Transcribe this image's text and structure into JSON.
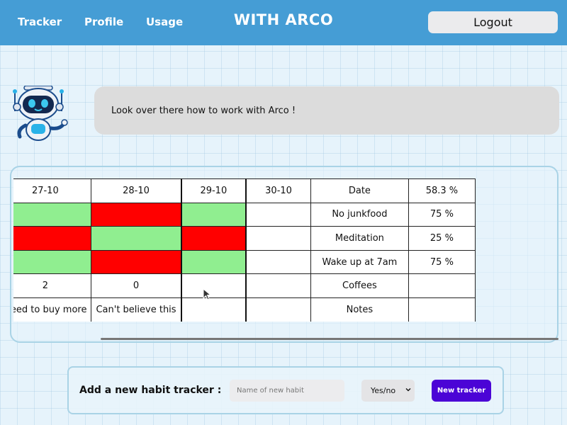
{
  "navbar": {
    "links": [
      "Tracker",
      "Profile",
      "Usage"
    ],
    "brand": "WITH ARCO",
    "logout_label": "Logout",
    "color": "#459dd5"
  },
  "assistant": {
    "message": "Look over there how to work with Arco !"
  },
  "tracker": {
    "first_col_partial": [
      "",
      "",
      "",
      "",
      "e"
    ],
    "dates": [
      "27-10",
      "28-10",
      "29-10",
      "30-10"
    ],
    "summary_header": {
      "label": "Date",
      "value": "58.3 %"
    },
    "rows": [
      {
        "label": "No junkfood",
        "value": "75 %",
        "cells": [
          "done",
          "done",
          "missed",
          "done",
          "empty"
        ]
      },
      {
        "label": "Meditation",
        "value": "25 %",
        "cells": [
          "missed",
          "missed",
          "done",
          "missed",
          "empty"
        ]
      },
      {
        "label": "Wake up at 7am",
        "value": "75 %",
        "cells": [
          "done",
          "done",
          "missed",
          "done",
          "empty"
        ]
      },
      {
        "label": "Coffees",
        "value": "",
        "cells": [
          "",
          "2",
          "0",
          "",
          ""
        ]
      },
      {
        "label": "Notes",
        "value": "",
        "cells": [
          "e",
          "Need to buy more",
          "Can't believe this",
          "",
          ""
        ]
      }
    ],
    "colors": {
      "done": "#90ee90",
      "missed": "#ff0000"
    }
  },
  "add_tracker": {
    "label": "Add a new habit tracker :",
    "input_placeholder": "Name of new habit",
    "input_value": "",
    "type_selected": "Yes/no",
    "button_label": "New tracker",
    "button_color": "#4b04d6"
  },
  "icons": {
    "robot": "robot-mascot-icon",
    "cursor": "mouse-pointer-icon",
    "select": "chevron-down-icon"
  }
}
